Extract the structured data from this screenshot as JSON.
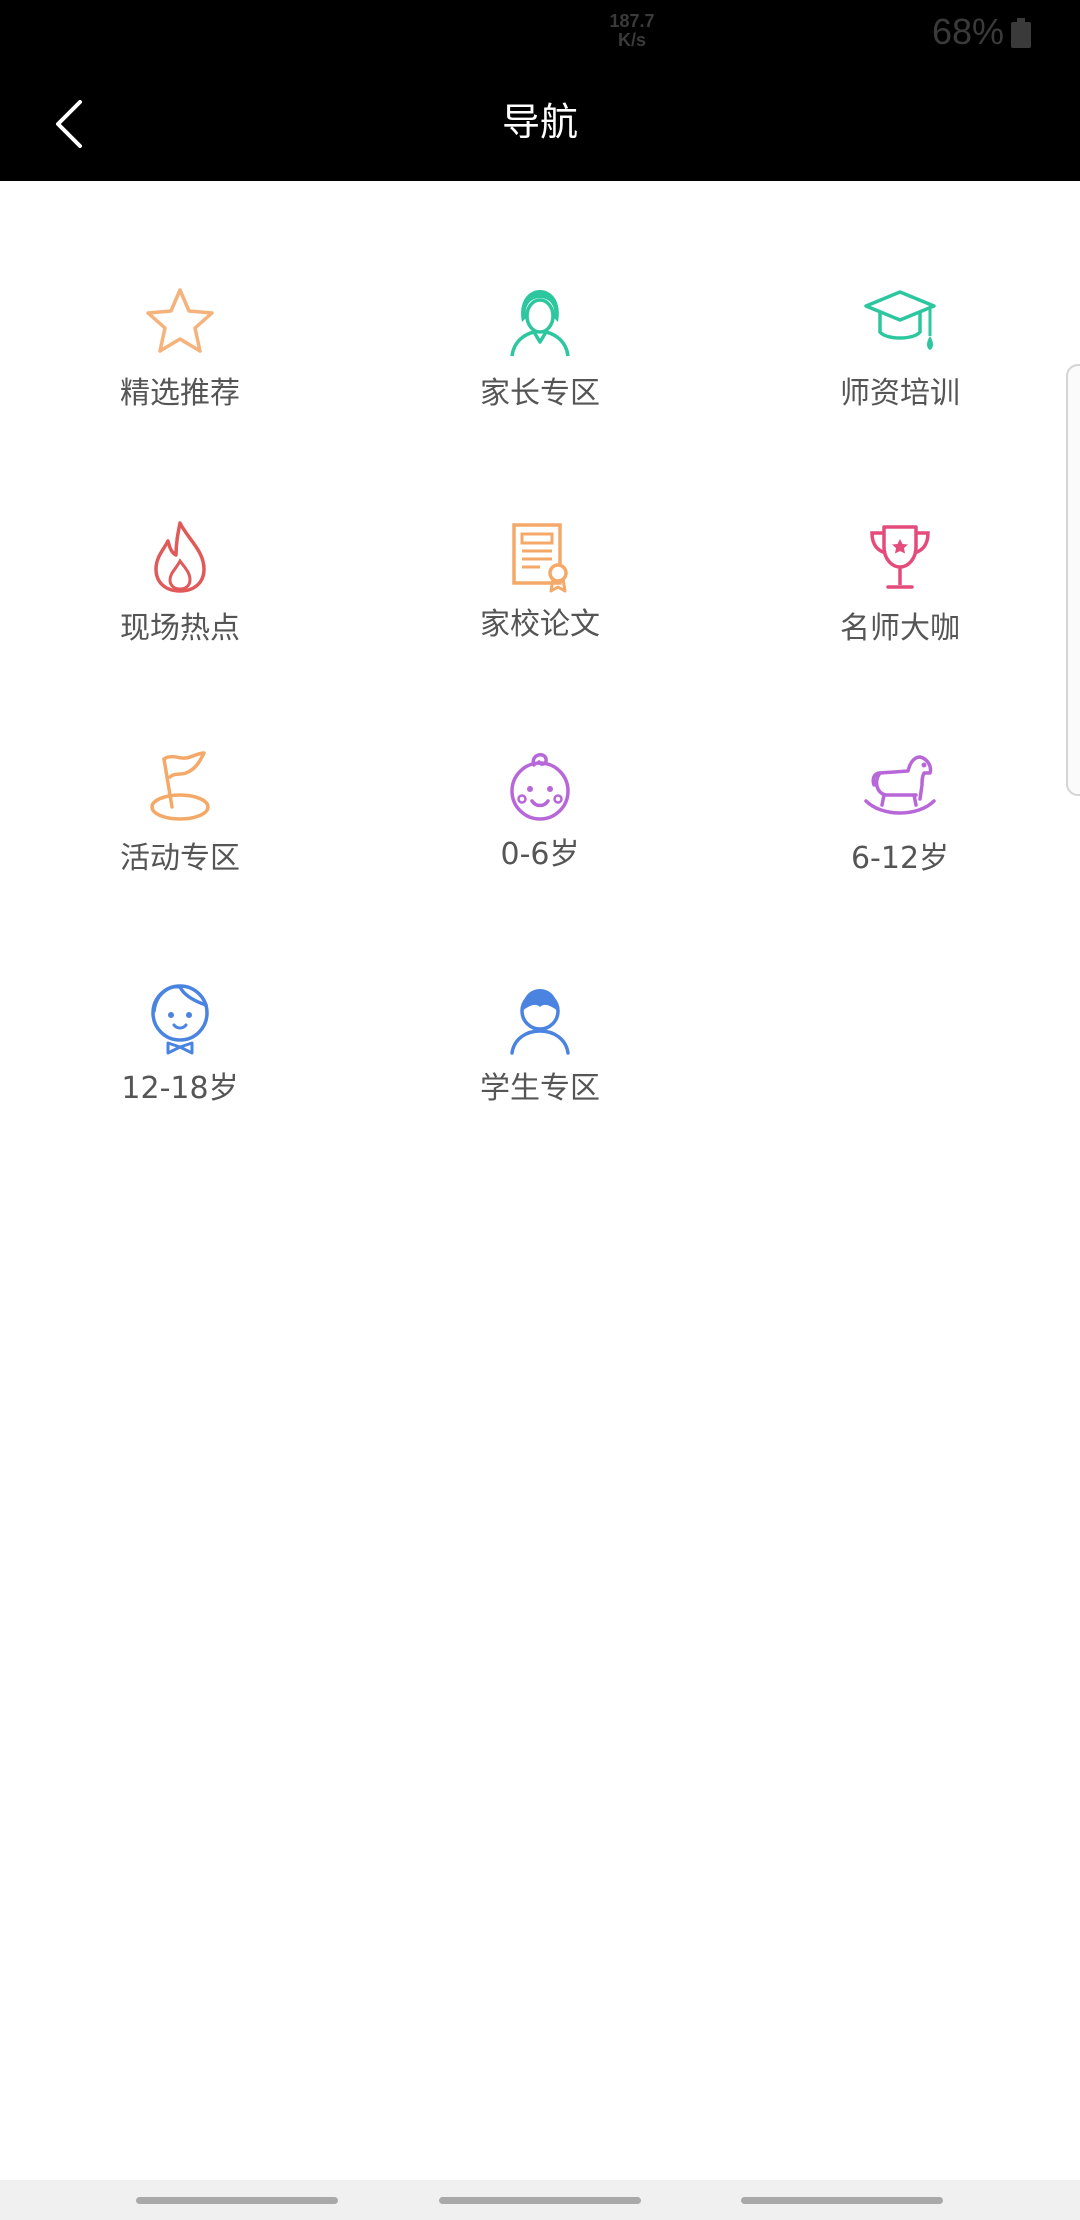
{
  "status_bar": {
    "net_speed_value": "187.7",
    "net_speed_unit": "K/s",
    "battery": "68%"
  },
  "app_bar": {
    "title": "导航",
    "back_icon": "chevron-left-icon"
  },
  "nav": {
    "items": [
      {
        "label": "精选推荐",
        "icon": "star-icon",
        "color": "#F5B27A"
      },
      {
        "label": "家长专区",
        "icon": "parent-icon",
        "color": "#2CC79E"
      },
      {
        "label": "师资培训",
        "icon": "graduation-cap-icon",
        "color": "#2CC79E"
      },
      {
        "label": "现场热点",
        "icon": "flame-icon",
        "color": "#E05A5A"
      },
      {
        "label": "家校论文",
        "icon": "certificate-icon",
        "color": "#F4A968"
      },
      {
        "label": "名师大咖",
        "icon": "trophy-icon",
        "color": "#E44B7A"
      },
      {
        "label": "活动专区",
        "icon": "flag-icon",
        "color": "#F4A968"
      },
      {
        "label": "0-6岁",
        "icon": "baby-face-icon",
        "color": "#B867D9"
      },
      {
        "label": "6-12岁",
        "icon": "rocking-horse-icon",
        "color": "#B867D9"
      },
      {
        "label": "12-18岁",
        "icon": "boy-face-icon",
        "color": "#4A84E0"
      },
      {
        "label": "学生专区",
        "icon": "student-icon",
        "color": "#4A84E0"
      }
    ]
  }
}
